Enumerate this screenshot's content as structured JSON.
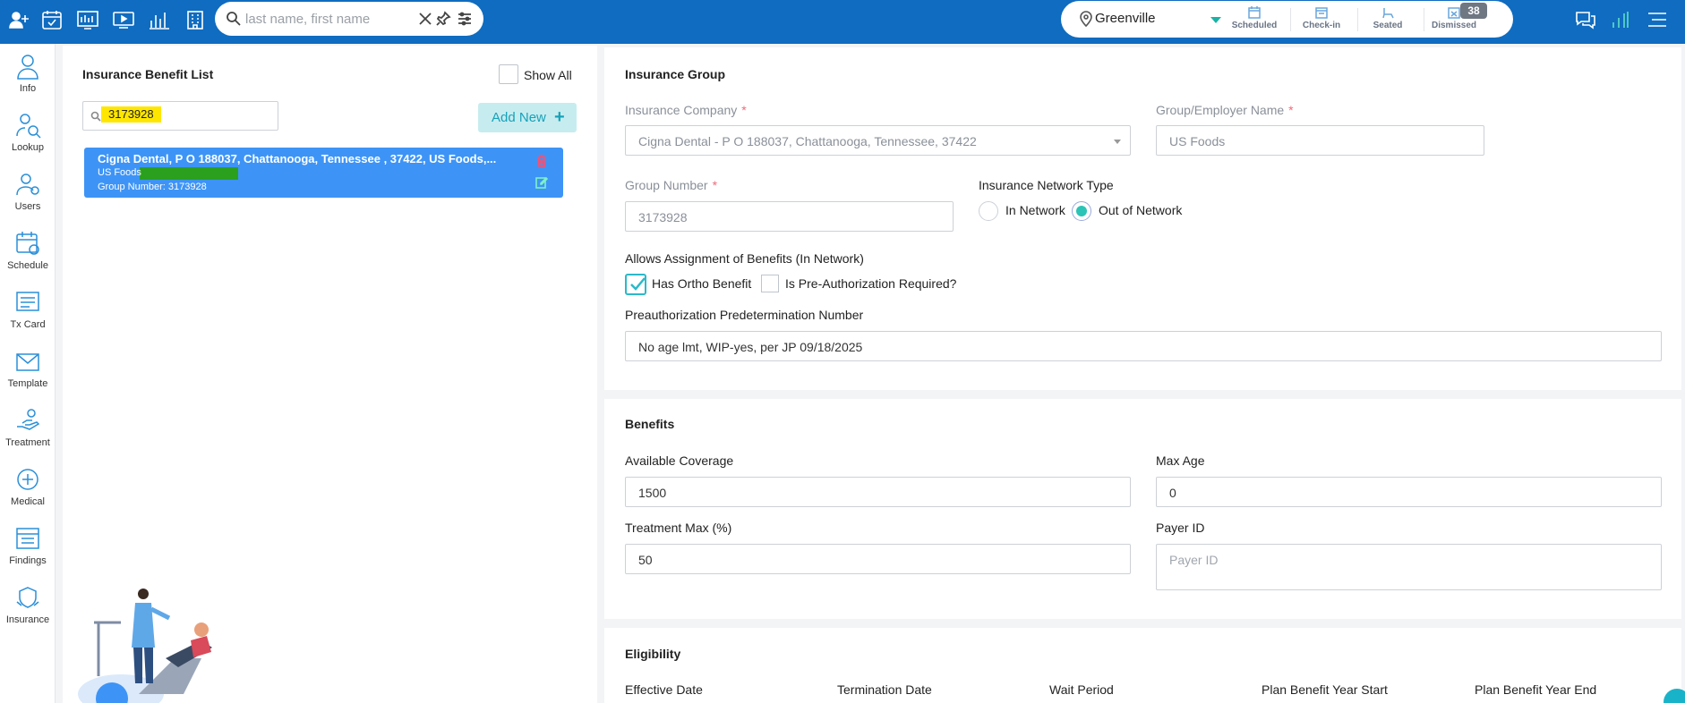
{
  "topbar": {
    "icons": [
      "add-user-icon",
      "calendar-check-icon",
      "dashboard-icon",
      "video-icon",
      "bar-chart-icon",
      "building-icon"
    ],
    "search": {
      "placeholder": "last name, first name",
      "value": ""
    },
    "location": "Greenville",
    "status": {
      "scheduled": "Scheduled",
      "checkin": "Check-in",
      "seated": "Seated",
      "dismissed": "Dismissed",
      "dismissed_count": "38"
    }
  },
  "sidebar": {
    "items": [
      {
        "label": "Info",
        "icon": "person-icon"
      },
      {
        "label": "Lookup",
        "icon": "person-search-icon"
      },
      {
        "label": "Users",
        "icon": "users-icon"
      },
      {
        "label": "Schedule",
        "icon": "calendar-icon"
      },
      {
        "label": "Tx Card",
        "icon": "card-icon"
      },
      {
        "label": "Template",
        "icon": "envelope-icon"
      },
      {
        "label": "Treatment",
        "icon": "hand-icon"
      },
      {
        "label": "Medical",
        "icon": "medical-icon"
      },
      {
        "label": "Findings",
        "icon": "findings-icon"
      },
      {
        "label": "Insurance",
        "icon": "insurance-icon"
      }
    ]
  },
  "benefit_list": {
    "title": "Insurance Benefit List",
    "show_all_label": "Show All",
    "show_all_checked": false,
    "search_value": "3173928",
    "add_new_label": "Add New",
    "entries": [
      {
        "title": "Cigna Dental, P O 188037, Chattanooga, Tennessee , 37422, US Foods,...",
        "employer": "US Foods",
        "group_number": "Group Number: 3173928"
      }
    ]
  },
  "insurance_group": {
    "title": "Insurance Group",
    "company_label": "Insurance Company",
    "company_value": "Cigna Dental - P O 188037, Chattanooga, Tennessee, 37422",
    "employer_label": "Group/Employer Name",
    "employer_value": "US Foods",
    "group_number_label": "Group Number",
    "group_number_value": "3173928",
    "network_type_label": "Insurance Network Type",
    "in_network_label": "In Network",
    "out_network_label": "Out of Network",
    "network_selected": "Out of Network",
    "allows_assignment_label": "Allows Assignment of Benefits (In Network)",
    "ortho_label": "Has Ortho Benefit",
    "ortho_checked": true,
    "preauth_required_label": "Is Pre-Authorization Required?",
    "preauth_required_checked": false,
    "preauth_number_label": "Preauthorization Predetermination Number",
    "preauth_number_value": "No age lmt, WIP-yes, per JP 09/18/2025"
  },
  "benefits": {
    "title": "Benefits",
    "coverage_label": "Available Coverage",
    "coverage_value": "1500",
    "max_age_label": "Max Age",
    "max_age_value": "0",
    "treatment_max_label": "Treatment Max (%)",
    "treatment_max_value": "50",
    "payer_id_label": "Payer ID",
    "payer_id_placeholder": "Payer ID"
  },
  "eligibility": {
    "title": "Eligibility",
    "columns": [
      "Effective Date",
      "Termination Date",
      "Wait Period",
      "Plan Benefit Year Start",
      "Plan Benefit Year End"
    ]
  }
}
